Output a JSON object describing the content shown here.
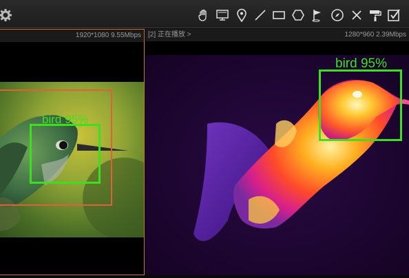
{
  "toolbar": {
    "tools": [
      "settings-gear-icon",
      "hand-pan-icon",
      "monitor-icon",
      "location-pin-icon",
      "line-draw-icon",
      "rectangle-draw-icon",
      "polygon-draw-icon",
      "flag-icon",
      "compass-icon",
      "close-x-icon",
      "paint-roller-icon",
      "checkbox-icon"
    ]
  },
  "left_pane": {
    "header_left": "",
    "header_right": "1920*1080 9.55Mbps",
    "detection_label": "bird 95%",
    "frame_color": "#c7772a"
  },
  "right_pane": {
    "header_left": "[2] 正在播放 >",
    "header_right": "1280*960 2.39Mbps",
    "detection_label": "bird 95%"
  },
  "colors": {
    "detection": "#3ce021",
    "track": "#e0603a"
  }
}
